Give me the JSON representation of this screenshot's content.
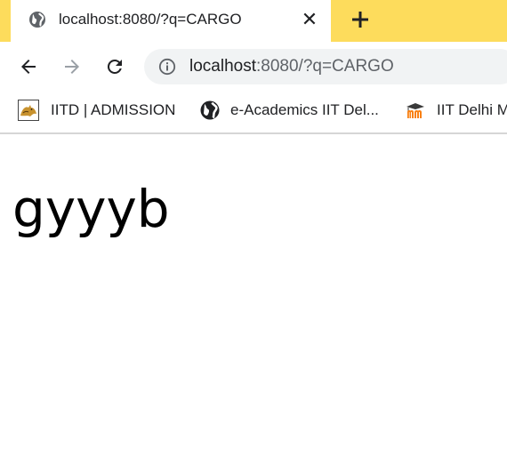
{
  "tab": {
    "title": "localhost:8080/?q=CARGO",
    "close_glyph": "✕"
  },
  "toolbar": {
    "url_host": "localhost",
    "url_rest": ":8080/?q=CARGO"
  },
  "bookmarks": [
    {
      "label": "IITD | ADMISSION",
      "icon": "tomcat-icon"
    },
    {
      "label": "e-Academics IIT Del...",
      "icon": "globe-icon"
    },
    {
      "label": "IIT Delhi M",
      "icon": "moodle-icon"
    }
  ],
  "page": {
    "text": "gyyyb"
  },
  "colors": {
    "tabstrip": "#fddc5c",
    "omnibox": "#f1f3f4"
  }
}
